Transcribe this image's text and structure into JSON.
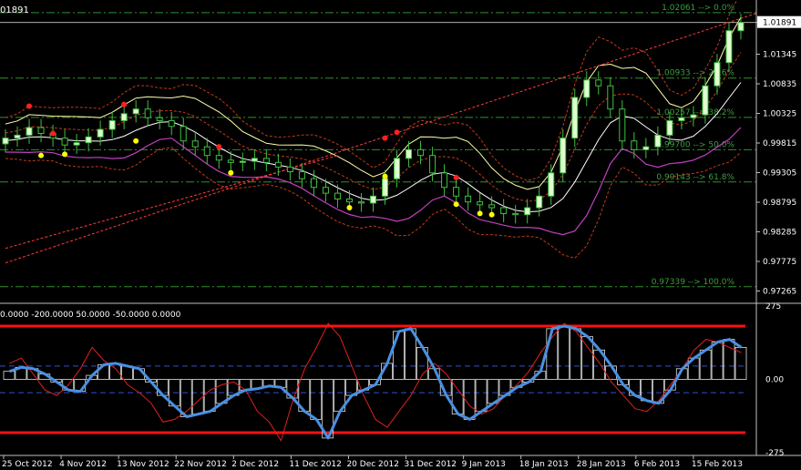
{
  "chart_data": [
    {
      "type": "candlestick",
      "symbol_fragment": "01891",
      "y_axis": {
        "ticks": [
          "1.01891",
          "1.01345",
          "1.00835",
          "1.00325",
          "0.99815",
          "0.99305",
          "0.98795",
          "0.98285",
          "0.97775",
          "0.97265"
        ],
        "current_price": "1.01891",
        "ylim": [
          0.97265,
          1.02061
        ]
      },
      "fibonacci_levels": [
        {
          "label": "1.02061 --> 0.0%",
          "value": 1.02061
        },
        {
          "label": "1.00933 --> 23.6%",
          "value": 1.00933
        },
        {
          "label": "1.00257 --> 38.2%",
          "value": 1.00257
        },
        {
          "label": "0.99700 --> 50.0%",
          "value": 0.997
        },
        {
          "label": "0.99143 --> 61.8%",
          "value": 0.99143
        },
        {
          "label": "0.97339 --> 100.0%",
          "value": 0.97339
        }
      ],
      "series": [
        {
          "name": "close",
          "values": [
            0.999,
            0.9995,
            1.0008,
            0.9998,
            0.999,
            0.9978,
            0.9982,
            0.9992,
            1.0005,
            1.002,
            1.0032,
            1.004,
            1.0025,
            1.002,
            1.001,
            0.9985,
            0.9975,
            0.996,
            0.9952,
            0.9948,
            0.995,
            0.9955,
            0.9948,
            0.994,
            0.9932,
            0.992,
            0.9905,
            0.9895,
            0.9885,
            0.988,
            0.9878,
            0.989,
            0.992,
            0.9955,
            0.997,
            0.996,
            0.993,
            0.9905,
            0.989,
            0.988,
            0.9875,
            0.987,
            0.986,
            0.9858,
            0.987,
            0.989,
            0.993,
            0.999,
            1.006,
            1.009,
            1.008,
            1.004,
            0.9985,
            0.997,
            0.9975,
            0.9995,
            1.002,
            1.0025,
            1.003,
            1.008,
            1.012,
            1.0175,
            1.0189
          ]
        },
        {
          "name": "up_arrows",
          "values": [
            null,
            null,
            null,
            0.996,
            null,
            0.9962,
            null,
            null,
            null,
            null,
            null,
            0.9985,
            null,
            null,
            null,
            null,
            null,
            null,
            null,
            0.993,
            null,
            null,
            null,
            null,
            null,
            null,
            null,
            null,
            null,
            0.987,
            null,
            null,
            0.9924,
            null,
            null,
            null,
            null,
            null,
            0.9876,
            null,
            0.986,
            0.9858,
            null,
            null,
            null,
            null,
            null,
            null,
            null,
            null,
            null,
            null,
            null,
            null,
            null,
            null,
            null,
            null,
            null,
            null,
            null,
            null,
            null
          ]
        },
        {
          "name": "down_arrows",
          "values": [
            null,
            null,
            1.0045,
            null,
            0.9998,
            null,
            null,
            null,
            null,
            null,
            1.0048,
            null,
            null,
            null,
            null,
            null,
            null,
            null,
            0.9975,
            null,
            null,
            null,
            null,
            null,
            null,
            null,
            null,
            null,
            null,
            null,
            null,
            null,
            0.999,
            1.0,
            null,
            null,
            null,
            null,
            0.9922,
            null,
            null,
            null,
            null,
            null,
            null,
            null,
            null,
            null,
            null,
            null,
            null,
            null,
            null,
            null,
            null,
            null,
            null,
            null,
            null,
            null,
            null,
            null,
            null
          ]
        }
      ]
    },
    {
      "type": "line",
      "header": "0.0000 -200.0000 50.0000 -50.0000 0.0000",
      "y_axis": {
        "ticks": [
          "275",
          "0.00",
          "-275"
        ],
        "ylim": [
          -275,
          275
        ]
      },
      "reference_lines": [
        200,
        -200,
        50,
        -50
      ],
      "series": [
        {
          "name": "cci_histogram_main",
          "values": [
            30,
            45,
            40,
            20,
            -10,
            -40,
            -45,
            15,
            55,
            60,
            50,
            40,
            -10,
            -60,
            -100,
            -140,
            -130,
            -120,
            -90,
            -60,
            -40,
            -35,
            -25,
            -30,
            -70,
            -120,
            -150,
            -220,
            -120,
            -60,
            -40,
            -20,
            60,
            180,
            190,
            120,
            40,
            -60,
            -130,
            -150,
            -120,
            -90,
            -60,
            -30,
            -10,
            30,
            190,
            200,
            190,
            160,
            110,
            50,
            -20,
            -60,
            -80,
            -90,
            -40,
            40,
            80,
            110,
            140,
            150,
            120
          ]
        },
        {
          "name": "cci_fast",
          "values": [
            60,
            80,
            20,
            -40,
            -60,
            -20,
            40,
            120,
            70,
            40,
            -20,
            -50,
            -90,
            -160,
            -150,
            -120,
            -80,
            -40,
            -20,
            -10,
            -40,
            -120,
            -160,
            -230,
            -80,
            40,
            120,
            210,
            160,
            50,
            -60,
            -150,
            -180,
            -120,
            -60,
            20,
            60,
            20,
            -40,
            -100,
            -130,
            -110,
            -60,
            -20,
            30,
            100,
            160,
            210,
            180,
            120,
            60,
            -10,
            -60,
            -110,
            -120,
            -80,
            -20,
            40,
            110,
            150,
            140,
            120,
            100
          ]
        }
      ]
    }
  ],
  "x_axis": {
    "labels": [
      "25 Oct 2012",
      "4 Nov 2012",
      "13 Nov 2012",
      "22 Nov 2012",
      "2 Dec 2012",
      "11 Dec 2012",
      "20 Dec 2012",
      "31 Dec 2012",
      "9 Jan 2013",
      "18 Jan 2013",
      "28 Jan 2013",
      "6 Feb 2013",
      "15 Feb 2013"
    ]
  },
  "colors": {
    "background": "#000000",
    "grid_fib": "#2f8f2f",
    "fib_text": "#3c9c3c",
    "bull_candle": "#dfffd0",
    "wick": "#40c040",
    "band_yellow": "#ffffa8",
    "band_white": "#ffffff",
    "band_red_dotted": "#c03a1a",
    "band_purple": "#c040c0",
    "trend_red": "#ff3a3a",
    "cci_blue": "#4a90e2",
    "cci_red": "#e02020",
    "level_red": "#ff1010",
    "level_blue": "#3050d0",
    "axis_text": "#ffffff",
    "arrow_red": "#ff2020",
    "arrow_yellow": "#ffff00"
  }
}
